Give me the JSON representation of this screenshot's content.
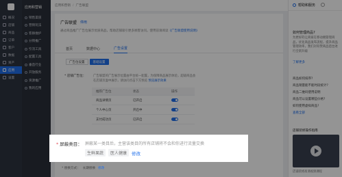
{
  "nav_primary": {
    "title": "应用和营销",
    "items": [
      "概况",
      "店铺",
      "商品",
      "订单",
      "客户",
      "数据",
      "资产",
      "应用",
      "设置"
    ],
    "active_index": 7
  },
  "nav_secondary": {
    "title": "应用和营销",
    "items": [
      "销售渠道",
      "营销玩法",
      "客群维护",
      "分销推广",
      "引流工具",
      "配置工具",
      "垂直行业",
      "开放服务",
      "资源推广",
      "我的应用"
    ]
  },
  "breadcrumb": [
    "应用和营销",
    "广告联盟"
  ],
  "page": {
    "title": "广告联盟",
    "switch_label": "停用",
    "description": "通过商品推广广告位展示优质商品，帮助店铺吸引更多顾客访问。使用前请阅读",
    "description_link": "《广告联盟使用说明》"
  },
  "tabs": [
    "首页",
    "数据中心",
    "广告设置"
  ],
  "active_tab": 2,
  "subtabs": [
    "广告位设置",
    "基础设置"
  ],
  "active_subtab": 1,
  "slot_section": {
    "label": "* 店铺广告位：",
    "desc": "广告联盟的广告展示位置由平台统一配置，为保障商品展示体验，超级商品会在店铺页面中展示，请访问点击下方预览",
    "link": "预览展示效果"
  },
  "slot_table": {
    "headers": [
      "推荐广告位",
      "状态",
      "操作"
    ],
    "rows": [
      {
        "name": "商品详情页",
        "status": "已开启"
      },
      {
        "name": "个人中心页",
        "status": "开启中"
      },
      {
        "name": "支付成功页",
        "status": "已开启"
      }
    ]
  },
  "highlight": {
    "required": "*",
    "label": "屏蔽类目：",
    "value": "屏蔽某一类目后，主营该类目的所有店铺将不会和你进行流量交换",
    "tags": [
      "生鲜果蔬",
      "医人健康"
    ],
    "edit": "修改"
  },
  "replace_row": {
    "label": "* 替换方式：",
    "value": "长期替换",
    "link": "修改"
  },
  "help_panel": {
    "title": "帮助和服务",
    "question": "如何管理商品?",
    "answer": "为更好的让商家在移动端管理商品，优化商品发布流程，提升商品管理效率，我们对有赞商品后台进行全新升级",
    "more": "了解更多",
    "questions": [
      "商品如何排序?",
      "商品销量能不能时段统计?",
      "商品二维码使用说明",
      "商品可以设置哪些价格?",
      "如何使用虚拟商品?"
    ],
    "all_questions": "查看全部",
    "video_title": "店铺装修操作指南",
    "video_caption": "店铺装修高清视频课程"
  }
}
